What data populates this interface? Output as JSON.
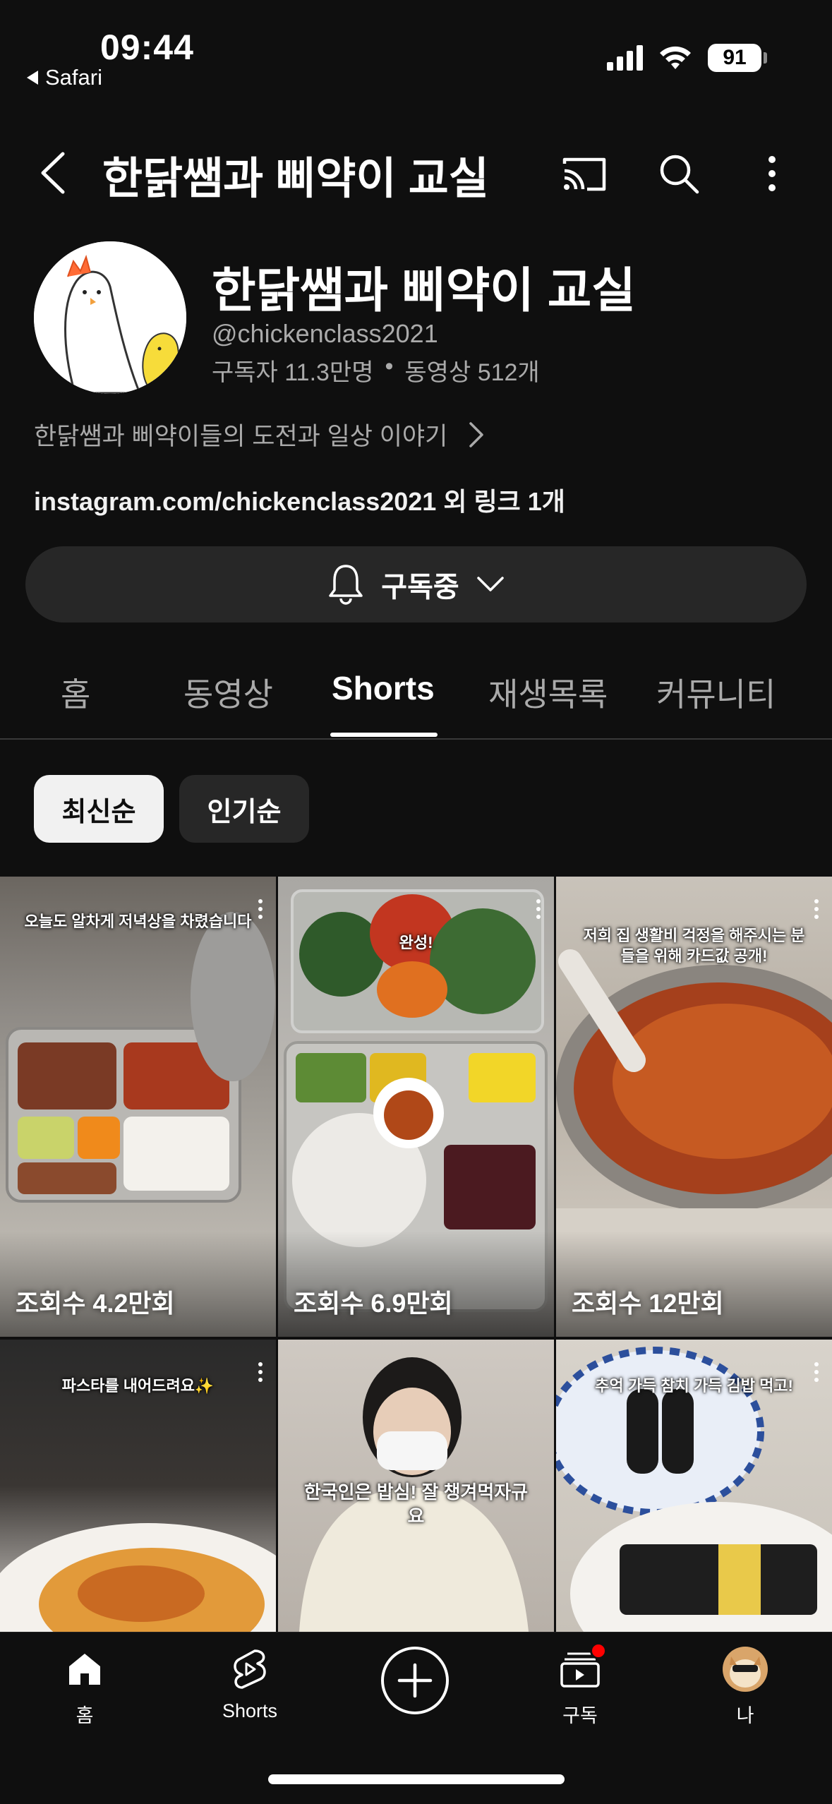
{
  "status_bar": {
    "time": "09:44",
    "back_app": "Safari",
    "battery": "91"
  },
  "nav": {
    "title": "한닭쌤과 삐약이 교실"
  },
  "channel": {
    "name": "한닭쌤과 삐약이 교실",
    "handle": "@chickenclass2021",
    "subscribers": "구독자 11.3만명",
    "separator": "•",
    "videos": "동영상 512개",
    "description": "한닭쌤과 삐약이들의 도전과 일상 이야기",
    "link": "instagram.com/chickenclass2021 외 링크 1개",
    "subscribe_label": "구독중"
  },
  "tabs": [
    {
      "label": "홈"
    },
    {
      "label": "동영상"
    },
    {
      "label": "Shorts"
    },
    {
      "label": "재생목록"
    },
    {
      "label": "커뮤니티"
    }
  ],
  "chips": [
    {
      "label": "최신순"
    },
    {
      "label": "인기순"
    }
  ],
  "shorts": [
    {
      "caption": "오늘도 알차게 저녁상을 차렸습니다",
      "views": "조회수 4.2만회"
    },
    {
      "caption": "완성!",
      "views": "조회수 6.9만회"
    },
    {
      "caption": "저희 집 생활비 걱정을 해주시는 분들을 위해 카드값 공개!",
      "views": "조회수 12만회"
    },
    {
      "caption": "파스타를 내어드려요✨",
      "views": ""
    },
    {
      "caption": "한국인은 밥심! 잘 챙겨먹자규요",
      "views": ""
    },
    {
      "caption": "추억 가득 참치 가득 김밥 먹고!",
      "views": ""
    }
  ],
  "bottom_nav": [
    {
      "label": "홈"
    },
    {
      "label": "Shorts"
    },
    {
      "label": "구독"
    },
    {
      "label": "나"
    }
  ],
  "colors": {
    "background": "#0f0f0f",
    "chip_selected": "#f1f1f1",
    "button_dark": "#272727",
    "accent_red": "#ff0000"
  }
}
